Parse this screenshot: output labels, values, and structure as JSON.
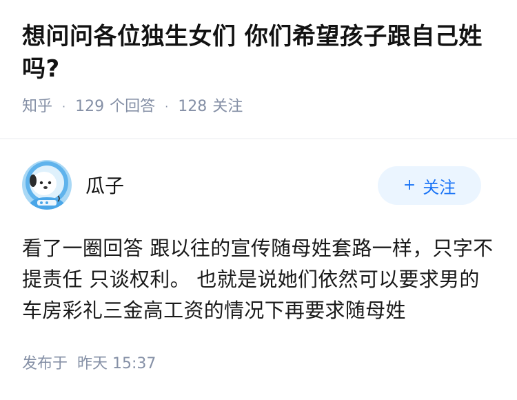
{
  "question": {
    "title": "想问问各位独生女们 你们希望孩子跟自己姓吗?",
    "source": "知乎",
    "answer_count": "129",
    "answer_unit": "个回答",
    "follower_count": "128",
    "follower_unit": "关注",
    "separator": "·"
  },
  "answer": {
    "author_name": "瓜子",
    "avatar_icon": "bear-astronaut-avatar-icon",
    "follow_label": "关注",
    "follow_icon": "plus-icon",
    "follow_symbol": "+",
    "content": "看了一圈回答 跟以往的宣传随母姓套路一样，只字不提责任 只谈权利。 也就是说她们依然可以要求男的车房彩礼三金高工资的情况下再要求随母姓",
    "publish_label": "发布于",
    "publish_time": "昨天 15:37"
  },
  "colors": {
    "accent": "#1772f6",
    "follow_bg": "#ebf5ff",
    "meta_text": "#8590a6",
    "title_text": "#121212",
    "avatar_bg": "#a9d8f5"
  }
}
